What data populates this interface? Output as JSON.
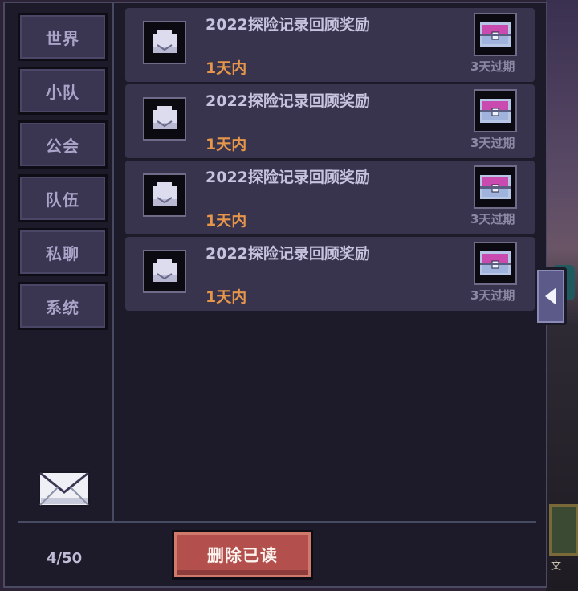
{
  "sidebar": {
    "tabs": [
      {
        "label": "世界"
      },
      {
        "label": "小队"
      },
      {
        "label": "公会"
      },
      {
        "label": "队伍"
      },
      {
        "label": "私聊"
      },
      {
        "label": "系统"
      }
    ]
  },
  "mails": [
    {
      "title": "2022探险记录回顾奖励",
      "time": "1天内",
      "expire": "3天过期",
      "icon": "envelope-icon",
      "attachment_icon": "treasure-chest-icon"
    },
    {
      "title": "2022探险记录回顾奖励",
      "time": "1天内",
      "expire": "3天过期",
      "icon": "envelope-icon",
      "attachment_icon": "treasure-chest-icon"
    },
    {
      "title": "2022探险记录回顾奖励",
      "time": "1天内",
      "expire": "3天过期",
      "icon": "envelope-icon",
      "attachment_icon": "treasure-chest-icon"
    },
    {
      "title": "2022探险记录回顾奖励",
      "time": "1天内",
      "expire": "3天过期",
      "icon": "envelope-icon",
      "attachment_icon": "treasure-chest-icon"
    }
  ],
  "footer": {
    "mail_count": "4/50",
    "delete_read_label": "删除已读"
  },
  "colors": {
    "panel_bg": "#1d1a29",
    "item_bg": "#39344d",
    "time_accent": "#e5964a",
    "button_red": "#b3504e"
  }
}
